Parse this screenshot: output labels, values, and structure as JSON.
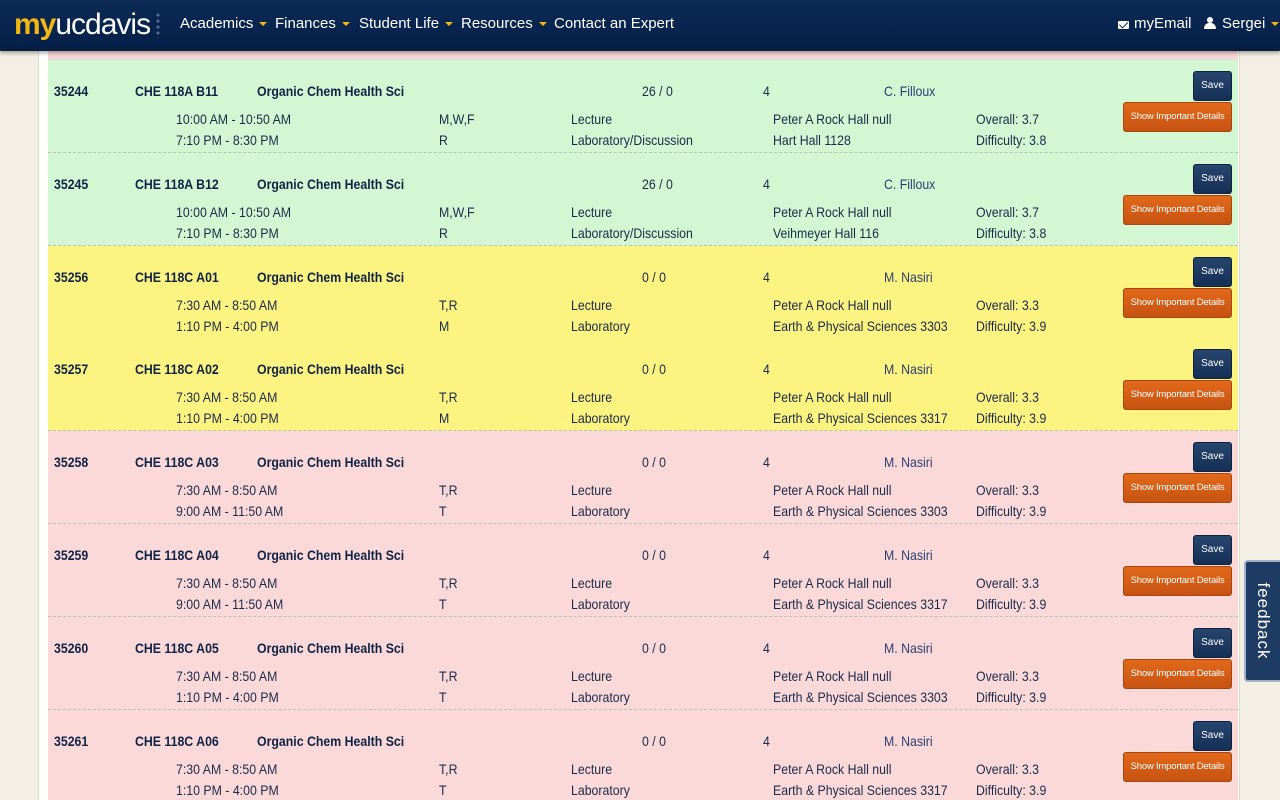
{
  "nav": {
    "logo_my": "my",
    "logo_ucdavis": "ucdavis",
    "items": [
      {
        "label": "Academics",
        "dropdown": true
      },
      {
        "label": "Finances",
        "dropdown": true
      },
      {
        "label": "Student Life",
        "dropdown": true
      },
      {
        "label": "Resources",
        "dropdown": true
      },
      {
        "label": "Contact an Expert",
        "dropdown": false
      }
    ],
    "email_label": "myEmail",
    "user_label": "Sergei"
  },
  "buttons": {
    "save": "Save",
    "details": "Show Important Details"
  },
  "feedback_label": "feedback",
  "colors": {
    "green": "#d2f7d2",
    "yellow": "#fdf380",
    "red": "#fbd9d9",
    "nav": "#0d2a56",
    "accent": "#f2b712",
    "details_button": "#d35d15"
  },
  "courses": [
    {
      "crn": "35244",
      "code": "CHE 118A B11",
      "title": "Organic Chem Health Sci",
      "seats": "26 / 0",
      "units": "4",
      "instructor": "C. Filloux",
      "status": "green",
      "meetings": [
        {
          "time": "10:00 AM - 10:50 AM",
          "days": "M,W,F",
          "type": "Lecture",
          "location": "Peter A Rock Hall null"
        },
        {
          "time": "7:10 PM - 8:30 PM",
          "days": "R",
          "type": "Laboratory/Discussion",
          "location": "Hart Hall 1128"
        }
      ],
      "overall": "Overall: 3.7",
      "difficulty": "Difficulty: 3.8"
    },
    {
      "crn": "35245",
      "code": "CHE 118A B12",
      "title": "Organic Chem Health Sci",
      "seats": "26 / 0",
      "units": "4",
      "instructor": "C. Filloux",
      "status": "green",
      "meetings": [
        {
          "time": "10:00 AM - 10:50 AM",
          "days": "M,W,F",
          "type": "Lecture",
          "location": "Peter A Rock Hall null"
        },
        {
          "time": "7:10 PM - 8:30 PM",
          "days": "R",
          "type": "Laboratory/Discussion",
          "location": "Veihmeyer Hall 116"
        }
      ],
      "overall": "Overall: 3.7",
      "difficulty": "Difficulty: 3.8"
    },
    {
      "crn": "35256",
      "code": "CHE 118C A01",
      "title": "Organic Chem Health Sci",
      "seats": "0 / 0",
      "units": "4",
      "instructor": "M. Nasiri",
      "status": "yellow",
      "meetings": [
        {
          "time": "7:30 AM - 8:50 AM",
          "days": "T,R",
          "type": "Lecture",
          "location": "Peter A Rock Hall null"
        },
        {
          "time": "1:10 PM - 4:00 PM",
          "days": "M",
          "type": "Laboratory",
          "location": "Earth & Physical Sciences 3303"
        }
      ],
      "overall": "Overall: 3.3",
      "difficulty": "Difficulty: 3.9"
    },
    {
      "crn": "35257",
      "code": "CHE 118C A02",
      "title": "Organic Chem Health Sci",
      "seats": "0 / 0",
      "units": "4",
      "instructor": "M. Nasiri",
      "status": "yellow",
      "meetings": [
        {
          "time": "7:30 AM - 8:50 AM",
          "days": "T,R",
          "type": "Lecture",
          "location": "Peter A Rock Hall null"
        },
        {
          "time": "1:10 PM - 4:00 PM",
          "days": "M",
          "type": "Laboratory",
          "location": "Earth & Physical Sciences 3317"
        }
      ],
      "overall": "Overall: 3.3",
      "difficulty": "Difficulty: 3.9"
    },
    {
      "crn": "35258",
      "code": "CHE 118C A03",
      "title": "Organic Chem Health Sci",
      "seats": "0 / 0",
      "units": "4",
      "instructor": "M. Nasiri",
      "status": "red",
      "meetings": [
        {
          "time": "7:30 AM - 8:50 AM",
          "days": "T,R",
          "type": "Lecture",
          "location": "Peter A Rock Hall null"
        },
        {
          "time": "9:00 AM - 11:50 AM",
          "days": "T",
          "type": "Laboratory",
          "location": "Earth & Physical Sciences 3303"
        }
      ],
      "overall": "Overall: 3.3",
      "difficulty": "Difficulty: 3.9"
    },
    {
      "crn": "35259",
      "code": "CHE 118C A04",
      "title": "Organic Chem Health Sci",
      "seats": "0 / 0",
      "units": "4",
      "instructor": "M. Nasiri",
      "status": "red",
      "meetings": [
        {
          "time": "7:30 AM - 8:50 AM",
          "days": "T,R",
          "type": "Lecture",
          "location": "Peter A Rock Hall null"
        },
        {
          "time": "9:00 AM - 11:50 AM",
          "days": "T",
          "type": "Laboratory",
          "location": "Earth & Physical Sciences 3317"
        }
      ],
      "overall": "Overall: 3.3",
      "difficulty": "Difficulty: 3.9"
    },
    {
      "crn": "35260",
      "code": "CHE 118C A05",
      "title": "Organic Chem Health Sci",
      "seats": "0 / 0",
      "units": "4",
      "instructor": "M. Nasiri",
      "status": "red",
      "meetings": [
        {
          "time": "7:30 AM - 8:50 AM",
          "days": "T,R",
          "type": "Lecture",
          "location": "Peter A Rock Hall null"
        },
        {
          "time": "1:10 PM - 4:00 PM",
          "days": "T",
          "type": "Laboratory",
          "location": "Earth & Physical Sciences 3303"
        }
      ],
      "overall": "Overall: 3.3",
      "difficulty": "Difficulty: 3.9"
    },
    {
      "crn": "35261",
      "code": "CHE 118C A06",
      "title": "Organic Chem Health Sci",
      "seats": "0 / 0",
      "units": "4",
      "instructor": "M. Nasiri",
      "status": "red",
      "meetings": [
        {
          "time": "7:30 AM - 8:50 AM",
          "days": "T,R",
          "type": "Lecture",
          "location": "Peter A Rock Hall null"
        },
        {
          "time": "1:10 PM - 4:00 PM",
          "days": "T",
          "type": "Laboratory",
          "location": "Earth & Physical Sciences 3317"
        }
      ],
      "overall": "Overall: 3.3",
      "difficulty": "Difficulty: 3.9"
    }
  ]
}
